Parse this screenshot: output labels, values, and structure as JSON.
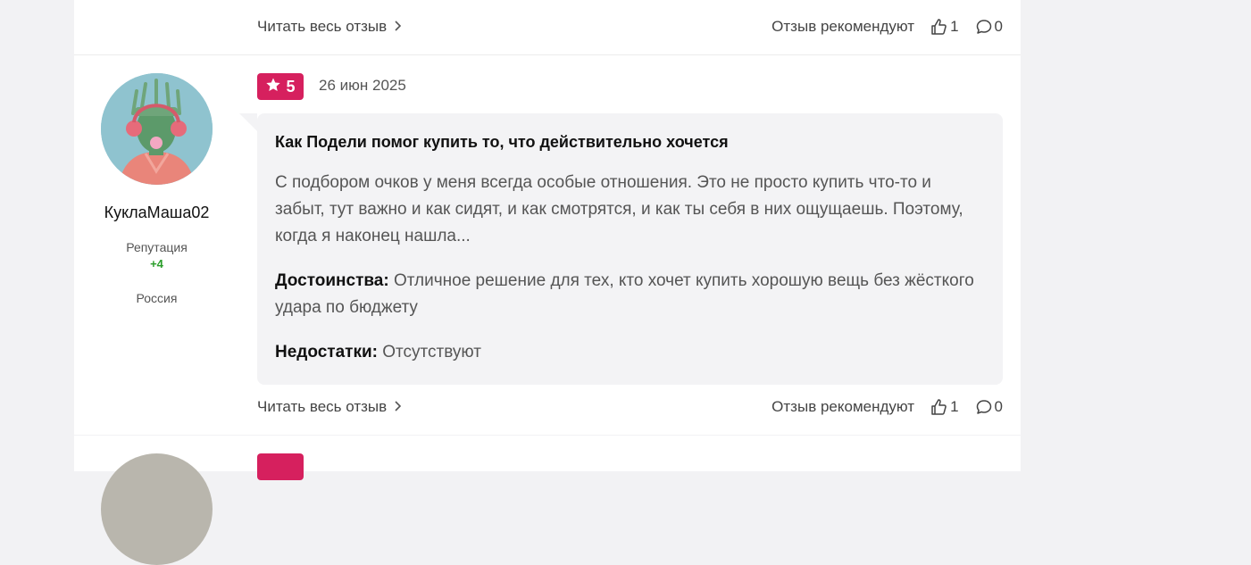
{
  "previous_review": {
    "read_more": "Читать весь отзыв",
    "recommend_label": "Отзыв рекомендуют",
    "likes": "1",
    "comments": "0"
  },
  "review": {
    "rating": "5",
    "date": "26 июн 2025",
    "author": {
      "name": "КуклаМаша02",
      "reputation_label": "Репутация",
      "reputation_value": "+4",
      "country": "Россия"
    },
    "title": "Как Подели помог купить то, что действительно хочется",
    "text": "С подбором очков у меня всегда особые отношения. Это не просто купить что-то и забыт, тут важно и как сидят, и как смотрятся, и как ты себя в них ощущаешь. Поэтому, когда я наконец нашла...",
    "pros_label": "Достоинства:",
    "pros": "Отличное решение для тех, кто хочет купить хорошую вещь без жёсткого удара по бюджету",
    "cons_label": "Недостатки:",
    "cons": "Отсутствуют",
    "read_more": "Читать весь отзыв",
    "recommend_label": "Отзыв рекомендуют",
    "likes": "1",
    "comments": "0"
  },
  "colors": {
    "accent": "#d6205e",
    "reputation": "#2a9d2a",
    "bubble": "#f3f3f5"
  },
  "icons": {
    "rating": "star-icon",
    "like": "thumbs-up-icon",
    "comment": "comment-icon",
    "chevron": "chevron-right-icon"
  }
}
